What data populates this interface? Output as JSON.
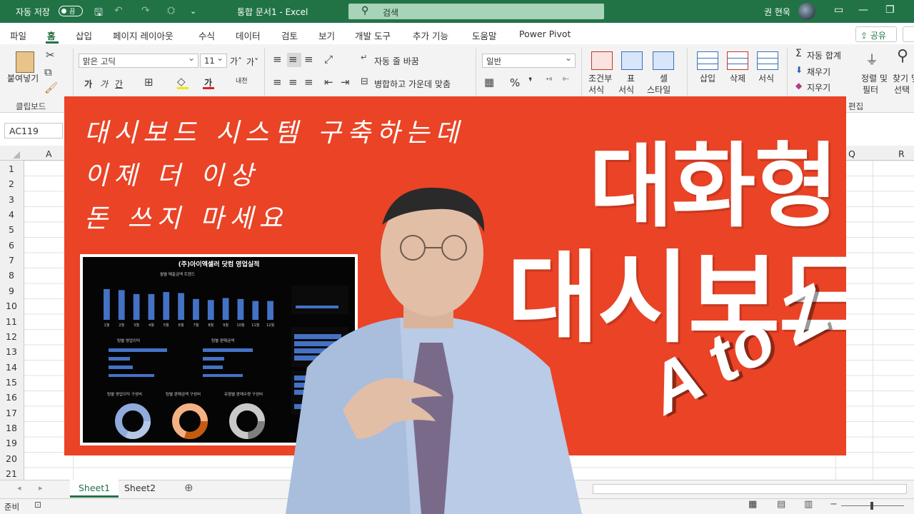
{
  "titlebar": {
    "autosave_label": "자동 저장",
    "autosave_state": "끔",
    "document_title": "통합 문서1  -  Excel",
    "search_placeholder": "검색",
    "user_name": "권 현욱"
  },
  "tabs": [
    "파일",
    "홈",
    "삽입",
    "페이지 레이아웃",
    "수식",
    "데이터",
    "검토",
    "보기",
    "개발 도구",
    "추가 기능",
    "도움말",
    "Power Pivot"
  ],
  "share_label": "공유",
  "ribbon": {
    "clipboard": {
      "paste_label": "붙여넣기",
      "group_label": "클립보드"
    },
    "font": {
      "font_name": "맑은 고딕",
      "font_size": "11",
      "grow": "가˄",
      "shrink": "가˅",
      "bold": "가",
      "italic": "가",
      "underline": "간",
      "color_letter": "가",
      "phonetic": "내천"
    },
    "alignment": {
      "wrap_text": "자동 줄 바꿈",
      "merge_center": "병합하고 가운데 맞춤"
    },
    "number": {
      "format": "일반",
      "percent": "%",
      "comma": "❜"
    },
    "styles": {
      "conditional_l1": "조건부",
      "conditional_l2": "서식",
      "table_l1": "표",
      "table_l2": "서식",
      "cell_l1": "셀",
      "cell_l2": "스타일"
    },
    "cells": {
      "insert": "삽입",
      "delete": "삭제",
      "format": "서식"
    },
    "editing": {
      "autosum": "자동 합계",
      "fill": "채우기",
      "clear": "지우기",
      "sort_l1": "정렬 및",
      "sort_l2": "필터",
      "find_l1": "찾기 및",
      "find_l2": "선택",
      "group_label": "편집"
    }
  },
  "namebox": "AC119",
  "columns": [
    "A",
    "Q",
    "R"
  ],
  "rows": [
    "1",
    "2",
    "3",
    "4",
    "5",
    "6",
    "7",
    "8",
    "9",
    "10",
    "11",
    "12",
    "13",
    "14",
    "15",
    "16",
    "17",
    "18",
    "19",
    "20",
    "21"
  ],
  "sheets": [
    "Sheet1",
    "Sheet2"
  ],
  "status_text": "준비",
  "thumbnail": {
    "line1": "대시보드 시스템 구축하는데",
    "line2": "이제 더 이상",
    "line3": "돈 쓰지 마세요",
    "big1": "대화형",
    "big2": "대시보드",
    "atoz": "A to Z",
    "dashboard_title": "(주)아이엑셀러 닷컴 영업실적",
    "chart1_title": "월별 매출금액 트렌드",
    "chart2_title": "팀별 영업이익",
    "chart3_title": "팀별 판매금액",
    "donut1_title": "팀별 영업이익 구성비",
    "donut2_title": "팀별 판매금액 구성비",
    "donut3_title": "유형별 판매수량 구성비"
  },
  "chart_data": {
    "type": "bar",
    "categories": [
      "1월",
      "2월",
      "3월",
      "4월",
      "5월",
      "6월",
      "7월",
      "8월",
      "9월",
      "10월",
      "11월",
      "12월"
    ],
    "values": [
      31,
      30,
      26,
      26,
      28,
      27,
      21,
      20,
      22,
      21,
      19,
      19
    ],
    "ylim": [
      0,
      36
    ]
  },
  "colors": {
    "excel_green": "#217346",
    "banner": "#ea4326",
    "dash_bar": "#4472c4"
  }
}
